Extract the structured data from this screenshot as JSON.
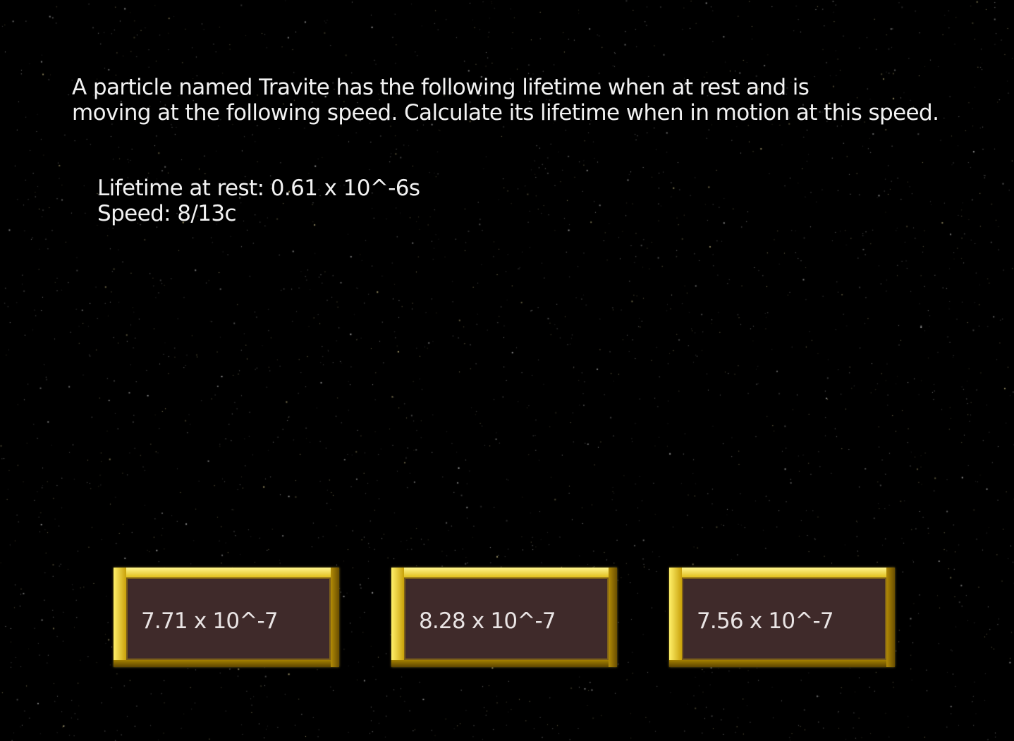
{
  "question": {
    "lines": [
      "A particle named Travite has the following lifetime when at rest and is",
      "moving at the following speed. Calculate its lifetime when in motion at this speed."
    ]
  },
  "given": {
    "lifetime_at_rest": "Lifetime at rest: 0.61 x 10^-6s",
    "speed": "Speed: 8/13c"
  },
  "answers": [
    {
      "label": "7.71 x 10^-7"
    },
    {
      "label": "8.28 x 10^-7"
    },
    {
      "label": "7.56 x 10^-7"
    }
  ],
  "colors": {
    "background": "#000000",
    "text": "#f2f2f2",
    "button_frame_gold": "#d8b20c",
    "button_face": "#3f2a2a",
    "stars": "#d8d4c0"
  }
}
